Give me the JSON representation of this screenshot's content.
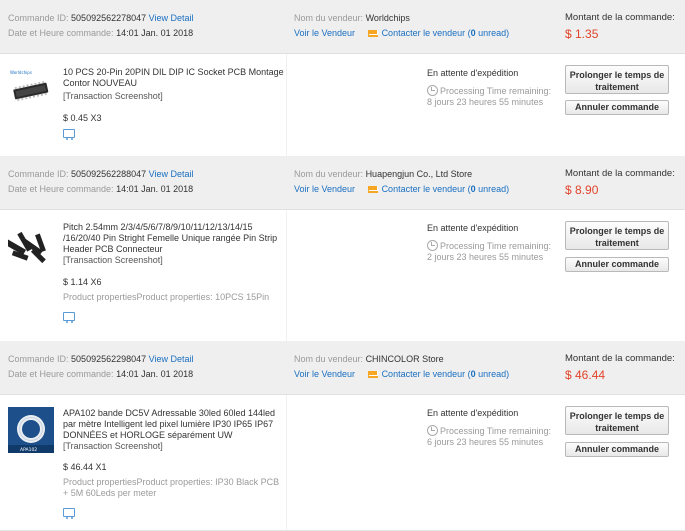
{
  "labels": {
    "order_id": "Commande ID:",
    "view_detail": "View Detail",
    "date_label": "Date et Heure commande:",
    "seller_label": "Nom du vendeur:",
    "voir_vendeur": "Voir le Vendeur",
    "contact_prefix": "Contacter le vendeur (",
    "contact_suffix": " unread)",
    "amount_label": "Montant de la commande:",
    "transaction": "[Transaction Screenshot]",
    "status_main": "En attente d'expédition",
    "processing": "Processing Time remaining:",
    "btn_extend": "Prolonger le temps de traitement",
    "btn_cancel": "Annuler commande"
  },
  "orders": [
    {
      "id": "505092562278047",
      "date": "14:01 Jan. 01 2018",
      "seller": "Worldchips",
      "unread": "0",
      "amount": "$ 1.35",
      "title": "10 PCS 20-Pin 20PIN DIL DIP IC Socket PCB Montage Contor NOUVEAU",
      "price": "$ 0.45 X3",
      "props": "",
      "remaining": "8 jours 23 heures 55 minutes"
    },
    {
      "id": "505092562288047",
      "date": "14:01 Jan. 01 2018",
      "seller": "Huapengjun Co., Ltd Store",
      "unread": "0",
      "amount": "$ 8.90",
      "title": "Pitch 2.54mm 2/3/4/5/6/7/8/9/10/11/12/13/14/15 /16/20/40 Pin Stright Femelle Unique rangée Pin Strip Header PCB Connecteur",
      "price": "$ 1.14 X6",
      "props": "Product propertiesProduct properties: 10PCS 15Pin",
      "remaining": "2 jours 23 heures 55 minutes"
    },
    {
      "id": "505092562298047",
      "date": "14:01 Jan. 01 2018",
      "seller": "CHINCOLOR Store",
      "unread": "0",
      "amount": "$ 46.44",
      "title": "APA102 bande DC5V Adressable 30led 60led 144led par mètre Intelligent led pixel lumière IP30 IP65 IP67 DONNÉES et HORLOGE séparément UW",
      "price": "$ 46.44 X1",
      "props": "Product propertiesProduct properties: IP30 Black PCB + 5M 60Leds per meter",
      "remaining": "6 jours 23 heures 55 minutes"
    }
  ],
  "colors": {
    "link": "#1a6fc1",
    "amount": "#e0442a",
    "header_bg": "#efefef"
  }
}
